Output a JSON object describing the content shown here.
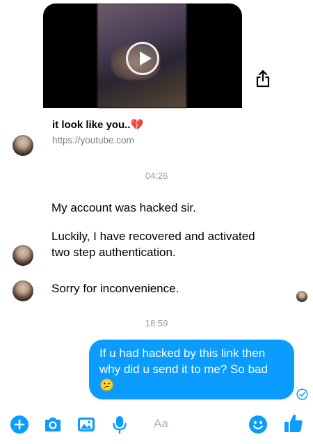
{
  "shared_link": {
    "title": "it look like you..",
    "title_emoji": "💔",
    "url": "https://youtube.com"
  },
  "timestamps": {
    "first": "04:26",
    "second": "18:59"
  },
  "incoming_messages": [
    "My account was hacked sir.",
    "Luckily, I have recovered and activated two step authentication.",
    "Sorry for inconvenience."
  ],
  "outgoing_message": {
    "text": "If u had hacked by this link then why did u send it to me? So bad",
    "emoji": "😕"
  },
  "composer": {
    "placeholder": "Aa"
  },
  "toolbar": {
    "icons": [
      "plus-icon",
      "camera-icon",
      "gallery-icon",
      "microphone-icon",
      "emoji-icon",
      "thumbs-up-icon"
    ]
  },
  "colors": {
    "accent": "#0a9cff",
    "bubble_text": "#ffffff",
    "timestamp": "#9c9c9c"
  }
}
